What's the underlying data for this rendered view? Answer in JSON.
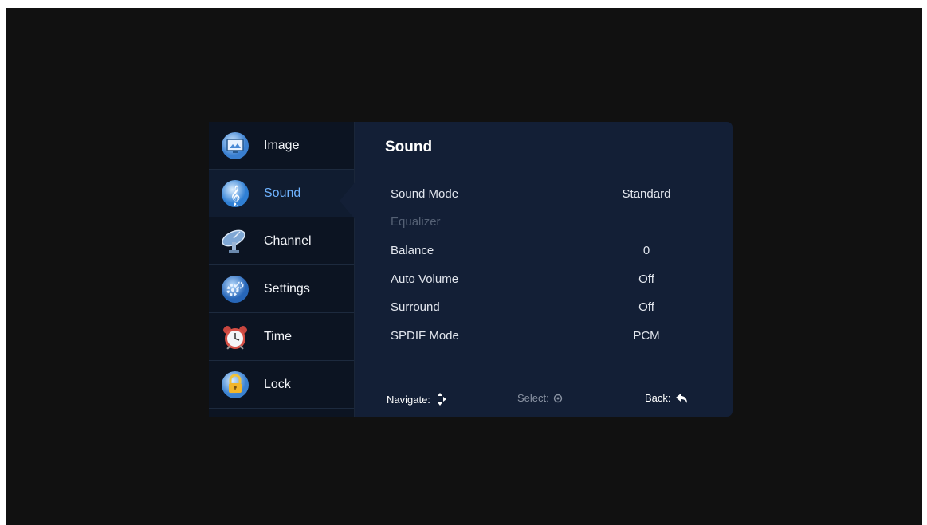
{
  "sidebar": {
    "items": [
      {
        "label": "Image",
        "icon": "image-icon"
      },
      {
        "label": "Sound",
        "icon": "sound-icon",
        "selected": true
      },
      {
        "label": "Channel",
        "icon": "satellite-dish-icon"
      },
      {
        "label": "Settings",
        "icon": "gear-icon"
      },
      {
        "label": "Time",
        "icon": "alarm-clock-icon"
      },
      {
        "label": "Lock",
        "icon": "padlock-icon"
      }
    ]
  },
  "panel": {
    "title": "Sound",
    "rows": [
      {
        "name": "Sound Mode",
        "value": "Standard"
      },
      {
        "name": "Equalizer",
        "value": "",
        "disabled": true
      },
      {
        "name": "Balance",
        "value": "0"
      },
      {
        "name": "Auto Volume",
        "value": "Off"
      },
      {
        "name": "Surround",
        "value": "Off"
      },
      {
        "name": "SPDIF Mode",
        "value": "PCM"
      }
    ]
  },
  "footer": {
    "navigate": "Navigate:",
    "select": "Select:",
    "back": "Back:"
  },
  "colors": {
    "background": "#111111",
    "sidebar": "#0c1422",
    "panel": "#131f36",
    "selected_text": "#6fb3ff"
  }
}
